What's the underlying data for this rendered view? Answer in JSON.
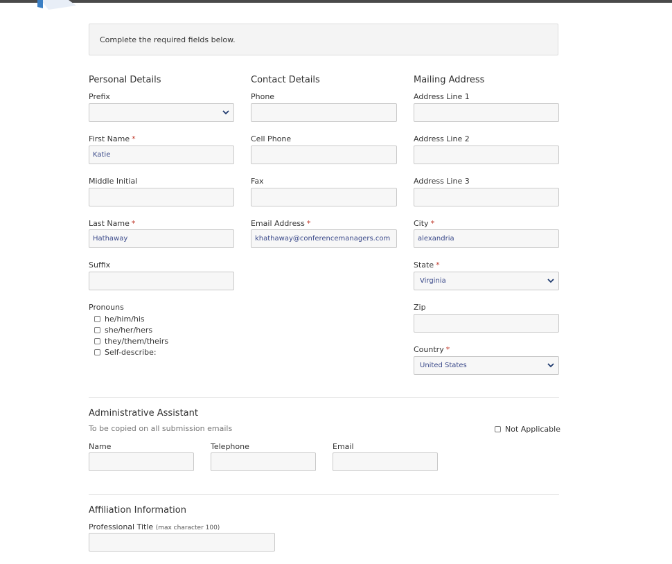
{
  "notice": "Complete the required fields below.",
  "personal": {
    "title": "Personal Details",
    "prefix_label": "Prefix",
    "prefix_value": "",
    "first_name_label": "First Name",
    "first_name_value": "Katie",
    "middle_initial_label": "Middle Initial",
    "middle_initial_value": "",
    "last_name_label": "Last Name",
    "last_name_value": "Hathaway",
    "suffix_label": "Suffix",
    "suffix_value": "",
    "pronouns_label": "Pronouns",
    "pronouns_options": [
      "he/him/his",
      "she/her/hers",
      "they/them/theirs",
      "Self-describe:"
    ]
  },
  "contact": {
    "title": "Contact Details",
    "phone_label": "Phone",
    "phone_value": "",
    "cell_label": "Cell Phone",
    "cell_value": "",
    "fax_label": "Fax",
    "fax_value": "",
    "email_label": "Email Address",
    "email_value": "khathaway@conferencemanagers.com"
  },
  "mailing": {
    "title": "Mailing Address",
    "address1_label": "Address Line 1",
    "address1_value": "",
    "address2_label": "Address Line 2",
    "address2_value": "",
    "address3_label": "Address Line 3",
    "address3_value": "",
    "city_label": "City",
    "city_value": "alexandria",
    "state_label": "State",
    "state_value": "Virginia",
    "zip_label": "Zip",
    "zip_value": "",
    "country_label": "Country",
    "country_value": "United States"
  },
  "required_marker": "*",
  "assistant": {
    "title": "Administrative Assistant",
    "subtitle": "To be copied on all submission emails",
    "not_applicable_label": "Not Applicable",
    "name_label": "Name",
    "name_value": "",
    "telephone_label": "Telephone",
    "telephone_value": "",
    "email_label": "Email",
    "email_value": ""
  },
  "affiliation": {
    "title": "Affiliation Information",
    "professional_title_label": "Professional Title",
    "professional_title_hint": "(max character 100)",
    "professional_title_value": ""
  },
  "colors": {
    "required": "#c0392b",
    "input_text": "#3b4a8a",
    "chevron": "#1f3a6e"
  }
}
